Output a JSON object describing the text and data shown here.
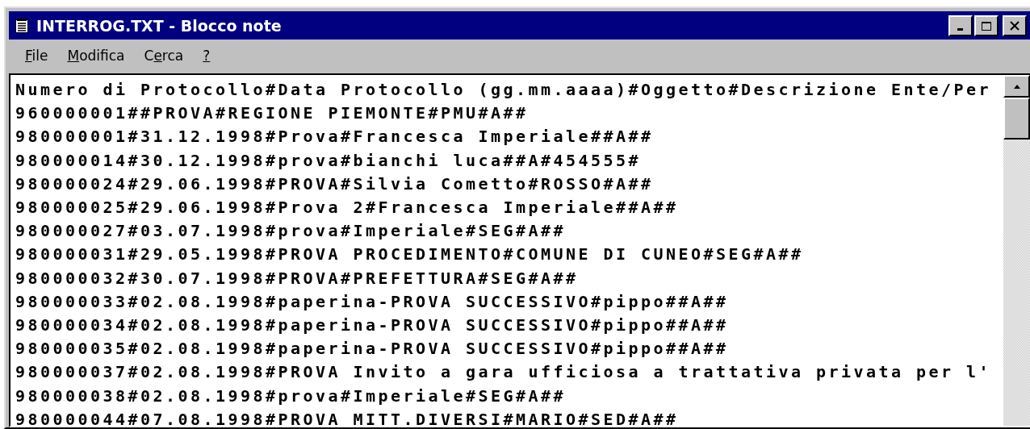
{
  "window": {
    "title": "INTERROG.TXT - Blocco note"
  },
  "menu": [
    {
      "parts": [
        {
          "text": "F",
          "underlined": true
        },
        {
          "text": "ile",
          "underlined": false
        }
      ]
    },
    {
      "parts": [
        {
          "text": "M",
          "underlined": true
        },
        {
          "text": "odifica",
          "underlined": false
        }
      ]
    },
    {
      "parts": [
        {
          "text": "C",
          "underlined": false
        },
        {
          "text": "e",
          "underlined": true
        },
        {
          "text": "rca",
          "underlined": false
        }
      ]
    },
    {
      "parts": [
        {
          "text": "?",
          "underlined": true
        }
      ]
    }
  ],
  "lines": [
    "Numero di Protocollo#Data Protocollo (gg.mm.aaaa)#Oggetto#Descrizione Ente/Per",
    "960000001##PROVA#REGIONE PIEMONTE#PMU#A##",
    "980000001#31.12.1998#Prova#Francesca Imperiale##A##",
    "980000014#30.12.1998#prova#bianchi luca##A#454555#",
    "980000024#29.06.1998#PROVA#Silvia Cometto#ROSSO#A##",
    "980000025#29.06.1998#Prova 2#Francesca Imperiale##A##",
    "980000027#03.07.1998#prova#Imperiale#SEG#A##",
    "980000031#29.05.1998#PROVA PROCEDIMENTO#COMUNE DI CUNEO#SEG#A##",
    "980000032#30.07.1998#PROVA#PREFETTURA#SEG#A##",
    "980000033#02.08.1998#paperina-PROVA SUCCESSIVO#pippo##A##",
    "980000034#02.08.1998#paperina-PROVA SUCCESSIVO#pippo##A##",
    "980000035#02.08.1998#paperina-PROVA SUCCESSIVO#pippo##A##",
    "980000037#02.08.1998#PROVA Invito a gara ufficiosa a trattativa privata per l'",
    "980000038#02.08.1998#prova#Imperiale#SEG#A##",
    "980000044#07.08.1998#PROVA MITT.DIVERSI#MARIO#SED#A##"
  ]
}
